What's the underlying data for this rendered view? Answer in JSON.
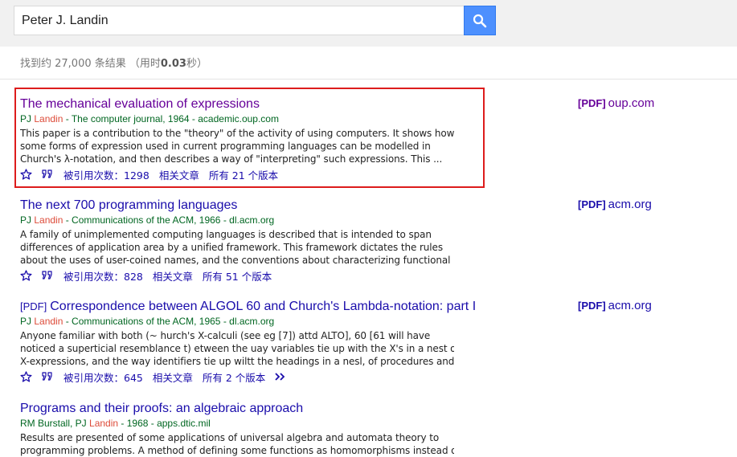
{
  "search": {
    "value": "Peter J. Landin"
  },
  "stats": {
    "prefix": "找到约 27,000 条结果 （用时",
    "time": "0.03",
    "suffix": "秒）"
  },
  "colors": {
    "link": "#1a0dab",
    "visited": "#660099",
    "green": "#006621",
    "highlight": "#dd4b39",
    "box": "#dd1c1c"
  },
  "results": [
    {
      "tag": "",
      "title": "The mechanical evaluation of expressions",
      "author_prefix": "PJ ",
      "author_hl": "Landin",
      "source": " - The computer journal, 1964 - academic.oup.com",
      "snippet": [
        "This paper is a contribution to the \"theory\" of the activity of using computers. It shows how",
        "some forms of expression used in current programming languages can be modelled in",
        "Church's λ-notation, and then describes a way of \"interpreting\" such expressions. This ..."
      ],
      "cited": "被引用次数：1298",
      "related": "相关文章",
      "versions": "所有 21 个版本",
      "pdf_tag": "[PDF]",
      "pdf_domain": "oup.com"
    },
    {
      "tag": "",
      "title": "The next 700 programming languages",
      "author_prefix": "PJ ",
      "author_hl": "Landin",
      "source": " - Communications of the ACM, 1966 - dl.acm.org",
      "snippet": [
        "A family of unimplemented computing languages is described that is intended to span",
        "differences of application area by a unified framework. This framework dictates the rules",
        "about the uses of user-coined names, and the conventions about characterizing functional ..."
      ],
      "cited": "被引用次数：828",
      "related": "相关文章",
      "versions": "所有 51 个版本",
      "pdf_tag": "[PDF]",
      "pdf_domain": "acm.org"
    },
    {
      "tag": "[PDF]",
      "title": "Correspondence between ALGOL 60 and Church's Lambda-notation: part I",
      "author_prefix": "PJ ",
      "author_hl": "Landin",
      "source": " - Communications of the ACM, 1965 - dl.acm.org",
      "snippet": [
        "Anyone familiar with both (~ hurch's X-calculi (see eg [7]) attd ALTO], 60 [61 will have",
        "noticed a superticial resemblance t) etween the uay variables tie up with the X's in a nest of",
        "X-expressions, and the way identifiers tie up wiltt the headings in a nesl, of procedures and ..."
      ],
      "cited": "被引用次数：645",
      "related": "相关文章",
      "versions": "所有 2 个版本",
      "pdf_tag": "[PDF]",
      "pdf_domain": "acm.org"
    },
    {
      "tag": "",
      "title": "Programs and their proofs: an algebraic approach",
      "author_prefix": "RM Burstall, PJ ",
      "author_hl": "Landin",
      "source": " - 1968 - apps.dtic.mil",
      "snippet": [
        "Results are presented of some applications of universal algebra and automata theory to",
        "programming problems. A method of defining some functions as homomorphisms instead of"
      ]
    }
  ]
}
